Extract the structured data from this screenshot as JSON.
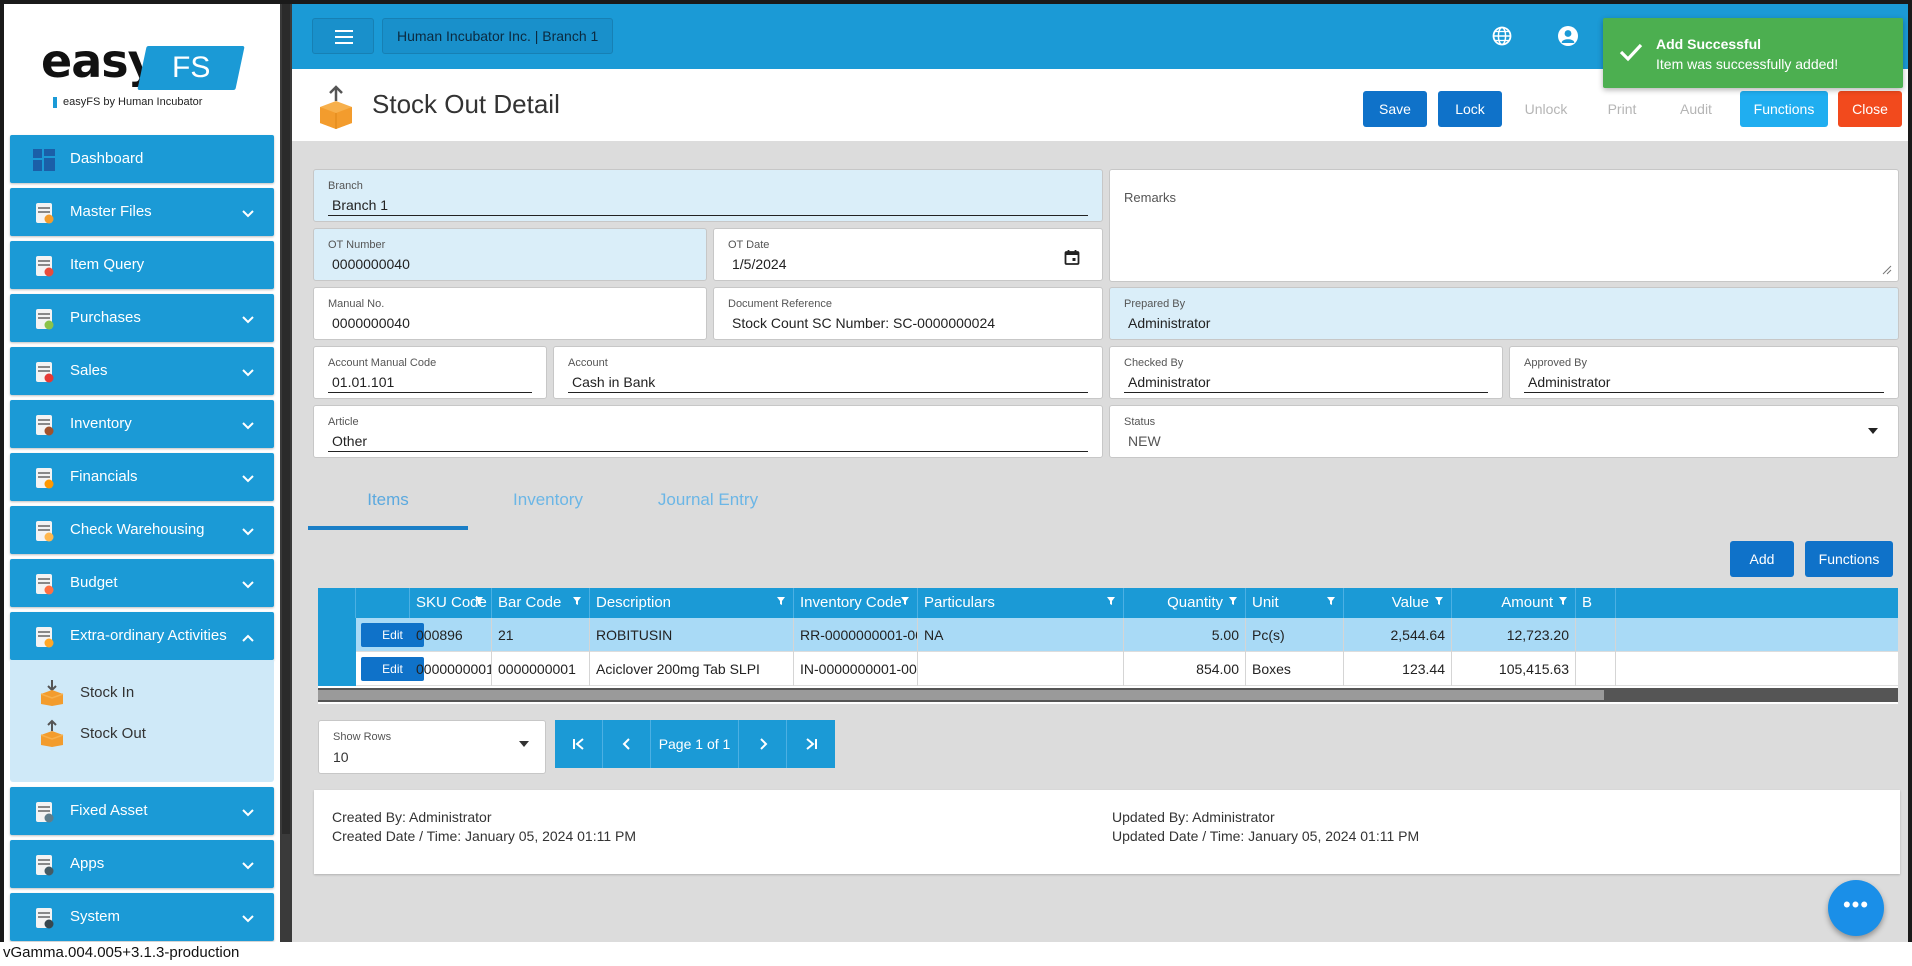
{
  "brand": {
    "logo_easy": "easy",
    "logo_fs": "FS",
    "tagline": "easyFS by Human Incubator"
  },
  "sidebar": {
    "items": [
      {
        "label": "Dashboard",
        "icon": "dashboard-icon",
        "expandable": false
      },
      {
        "label": "Master Files",
        "icon": "master-files-icon",
        "expandable": true
      },
      {
        "label": "Item Query",
        "icon": "basket-icon",
        "expandable": false
      },
      {
        "label": "Purchases",
        "icon": "clipboard-icon",
        "expandable": true
      },
      {
        "label": "Sales",
        "icon": "sale-tag-icon",
        "expandable": true
      },
      {
        "label": "Inventory",
        "icon": "boxes-icon",
        "expandable": true
      },
      {
        "label": "Financials",
        "icon": "ledger-icon",
        "expandable": true
      },
      {
        "label": "Check Warehousing",
        "icon": "check-icon",
        "expandable": true
      },
      {
        "label": "Budget",
        "icon": "pie-chart-icon",
        "expandable": true
      },
      {
        "label": "Extra-ordinary Activities",
        "icon": "activities-icon",
        "expandable": true,
        "expanded": true
      },
      {
        "label": "Fixed Asset",
        "icon": "fixed-asset-icon",
        "expandable": true
      },
      {
        "label": "Apps",
        "icon": "apps-icon",
        "expandable": true
      },
      {
        "label": "System",
        "icon": "system-gear-icon",
        "expandable": true
      }
    ],
    "sub_items": [
      {
        "label": "Stock In",
        "icon": "stock-in-icon"
      },
      {
        "label": "Stock Out",
        "icon": "stock-out-icon"
      }
    ]
  },
  "topbar": {
    "company": "Human Incubator Inc. | Branch 1"
  },
  "toast": {
    "title": "Add Successful",
    "message": "Item was successfully added!"
  },
  "header": {
    "title": "Stock Out Detail",
    "buttons": {
      "save": "Save",
      "lock": "Lock",
      "unlock": "Unlock",
      "print": "Print",
      "audit": "Audit",
      "functions": "Functions",
      "close": "Close"
    }
  },
  "form": {
    "branch": {
      "label": "Branch",
      "value": "Branch 1"
    },
    "remarks": {
      "label": "Remarks",
      "value": ""
    },
    "ot_number": {
      "label": "OT Number",
      "value": "0000000040"
    },
    "ot_date": {
      "label": "OT Date",
      "value": "1/5/2024"
    },
    "manual_no": {
      "label": "Manual No.",
      "value": "0000000040"
    },
    "document_reference": {
      "label": "Document Reference",
      "value": "Stock Count SC Number: SC-0000000024"
    },
    "prepared_by": {
      "label": "Prepared By",
      "value": "Administrator"
    },
    "account_manual_code": {
      "label": "Account Manual Code",
      "value": "01.01.101"
    },
    "account": {
      "label": "Account",
      "value": "Cash in Bank"
    },
    "checked_by": {
      "label": "Checked By",
      "value": "Administrator"
    },
    "approved_by": {
      "label": "Approved By",
      "value": "Administrator"
    },
    "article": {
      "label": "Article",
      "value": "Other"
    },
    "status": {
      "label": "Status",
      "value": "NEW"
    }
  },
  "tabs": [
    "Items",
    "Inventory",
    "Journal Entry"
  ],
  "grid_buttons": {
    "add": "Add",
    "functions": "Functions"
  },
  "table": {
    "columns": [
      "SKU Code",
      "Bar Code",
      "Description",
      "Inventory Code",
      "Particulars",
      "Quantity",
      "Unit",
      "Value",
      "Amount",
      "B"
    ],
    "edit_label": "Edit",
    "rows": [
      {
        "sku": "000896",
        "bar": "21",
        "desc": "ROBITUSIN",
        "inv": "RR-0000000001-00...",
        "part": "NA",
        "qty": "5.00",
        "unit": "Pc(s)",
        "value": "2,544.64",
        "amount": "12,723.20"
      },
      {
        "sku": "0000000001",
        "bar": "0000000001",
        "desc": "Aciclover 200mg Tab SLPI",
        "inv": "IN-0000000001-000...",
        "part": "",
        "qty": "854.00",
        "unit": "Boxes",
        "value": "123.44",
        "amount": "105,415.63"
      }
    ]
  },
  "pager": {
    "show_rows_label": "Show Rows",
    "show_rows_value": "10",
    "page_text": "Page 1 of 1"
  },
  "audit": {
    "created_by": "Created By: Administrator",
    "created_date": "Created Date / Time: January 05, 2024 01:11 PM",
    "updated_by": "Updated By: Administrator",
    "updated_date": "Updated Date / Time: January 05, 2024 01:11 PM"
  },
  "fab_label": "•••",
  "version": "vGamma.004.005+3.1.3-production"
}
